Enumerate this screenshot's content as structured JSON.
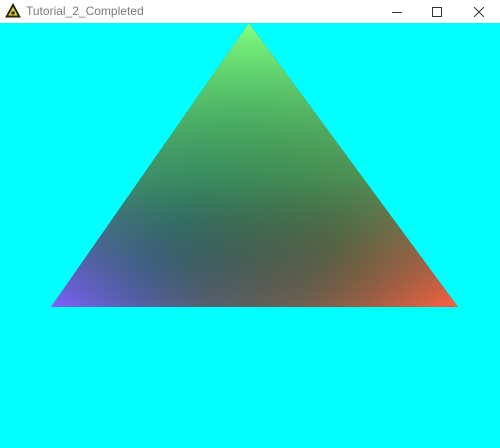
{
  "window": {
    "title": "Tutorial_2_Completed",
    "icon": "triangle-app-icon",
    "controls": {
      "minimize_icon": "minimize-icon",
      "maximize_icon": "maximize-icon",
      "close_icon": "close-icon"
    }
  },
  "viewport": {
    "clear_color": "#00ffff",
    "shape": "triangle",
    "vertex_colors": {
      "top": "#80ff80",
      "bottom_left": "#8060ff",
      "bottom_right": "#ff6040"
    },
    "center_color": "#104030"
  }
}
